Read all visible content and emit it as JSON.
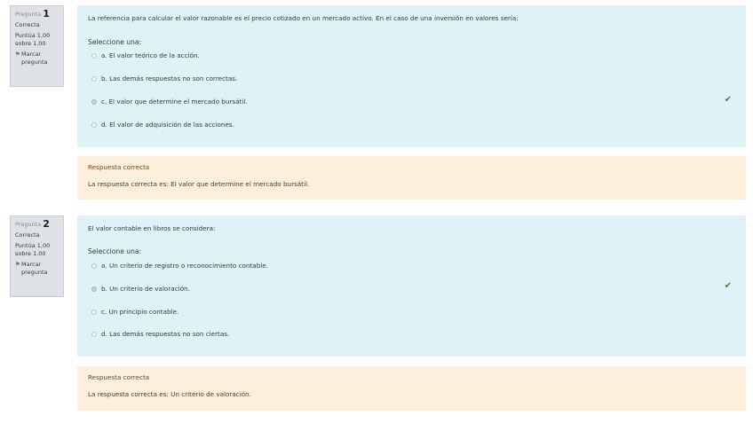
{
  "questions": [
    {
      "info": {
        "label": "Pregunta",
        "number": "1",
        "state": "Correcta",
        "grade": "Puntúa 1,00 sobre 1,00",
        "flag": "Marcar pregunta"
      },
      "text": "La referencia para calcular el valor razonable es el precio cotizado en un mercado activo. En el caso de una inversión en valores sería:",
      "prompt": "Seleccione una:",
      "options": [
        {
          "label": "a. El valor teórico de la acción.",
          "selected": false
        },
        {
          "label": "b. Las demás respuestas no son correctas.",
          "selected": false
        },
        {
          "label": "c. El valor que determine el mercado bursátil.",
          "selected": true
        },
        {
          "label": "d. El valor de adquisición de las acciones.",
          "selected": false
        }
      ],
      "feedback": "Respuesta correcta",
      "right_answer": "La respuesta correcta es: El valor que determine el mercado bursátil."
    },
    {
      "info": {
        "label": "Pregunta",
        "number": "2",
        "state": "Correcta",
        "grade": "Puntúa 1,00 sobre 1,00",
        "flag": "Marcar pregunta"
      },
      "text": "El valor contable en libros se considera:",
      "prompt": "Seleccione una:",
      "options": [
        {
          "label": "a. Un criterio de registro o reconocimiento contable.",
          "selected": false
        },
        {
          "label": "b. Un criterio de valoración.",
          "selected": true
        },
        {
          "label": "c. Un principio contable.",
          "selected": false
        },
        {
          "label": "d. Las demás respuestas no son ciertas.",
          "selected": false
        }
      ],
      "feedback": "Respuesta correcta",
      "right_answer": "La respuesta correcta es: Un criterio de valoración."
    }
  ],
  "colors": {
    "formulation_bg": "#def2f8",
    "outcome_bg": "#fcefdc",
    "info_bg": "#dee2e6",
    "correct_check": "#378c2c"
  },
  "icons": {
    "correct": "check-icon",
    "flag": "flag-icon"
  }
}
